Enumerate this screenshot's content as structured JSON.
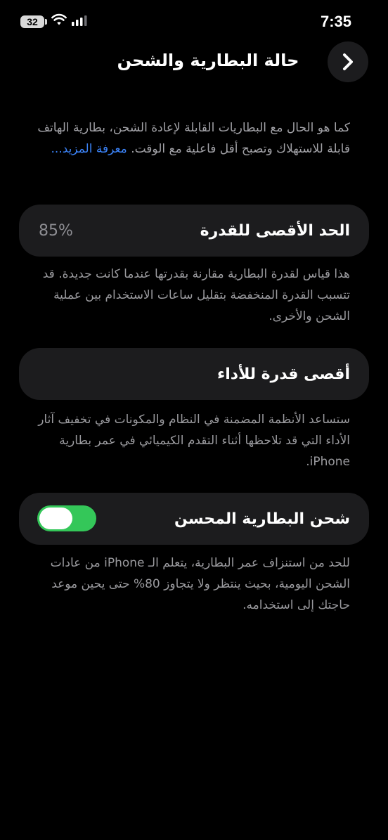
{
  "status_bar": {
    "battery_level": "32",
    "time": "7:35"
  },
  "nav": {
    "title": "حالة البطارية والشحن"
  },
  "intro": {
    "text": "كما هو الحال مع البطاريات القابلة لإعادة الشحن، بطارية الهاتف قابلة للاستهلاك وتصبح أقل فاعلية مع الوقت.",
    "link": "معرفة المزيد..."
  },
  "max_capacity": {
    "label": "الحد الأقصى للقدرة",
    "value": "85%",
    "description": "هذا قياس لقدرة البطارية مقارنة بقدرتها عندما كانت جديدة. قد تتسبب القدرة المنخفضة بتقليل ساعات الاستخدام بين عملية الشحن والأخرى."
  },
  "peak_performance": {
    "label": "أقصى قدرة للأداء",
    "description": "ستساعد الأنظمة المضمنة في النظام والمكونات في تخفيف آثار الأداء التي قد تلاحظها أثناء التقدم الكيميائي في عمر بطارية iPhone."
  },
  "optimized_charging": {
    "label": "شحن البطارية المحسن",
    "enabled": true,
    "description": "للحد من استنزاف عمر البطارية، يتعلم الـ iPhone من عادات الشحن اليومية، بحيث ينتظر ولا يتجاوز 80% حتى يحين موعد حاجتك إلى استخدامه."
  },
  "colors": {
    "background": "#000000",
    "card": "#1c1c1e",
    "toggle_on": "#34c759",
    "link": "#3b82f6",
    "secondary_text": "#9a9a9e"
  }
}
